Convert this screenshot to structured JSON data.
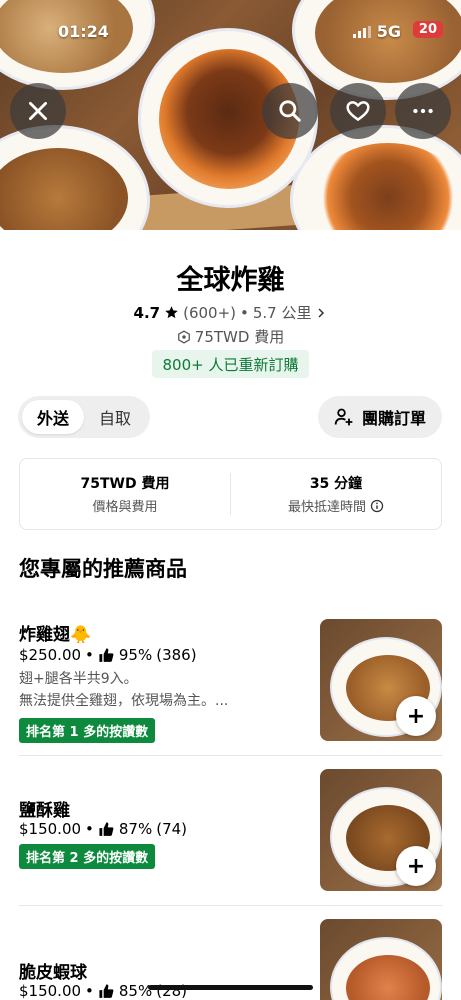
{
  "status_bar": {
    "time": "01:24",
    "network": "5G",
    "battery": "20"
  },
  "header_buttons": {
    "close": "close-icon",
    "search": "search-icon",
    "favorite": "heart-icon",
    "more": "more-icon"
  },
  "store": {
    "name": "全球炸雞",
    "rating": "4.7",
    "reviews": "(600+)",
    "distance": "5.7 公里",
    "fee": "75TWD 費用",
    "reorder_badge": "800+ 人已重新訂購"
  },
  "mode_toggle": {
    "options": [
      "外送",
      "自取"
    ],
    "selected": "外送"
  },
  "group_order": {
    "label": "團購訂單"
  },
  "info": {
    "fee_value": "75TWD 費用",
    "fee_label": "價格與費用",
    "time_value": "35 分鐘",
    "time_label": "最快抵達時間"
  },
  "section_title": "您專屬的推薦商品",
  "items": [
    {
      "name": "炸雞翅🐥",
      "price": "$250.00",
      "approval": "95%",
      "votes": "(386)",
      "desc1": "翅+腿各半共9入。",
      "desc2": "無法提供全雞翅，依現場為主。...",
      "badge": "排名第 1 多的按讚數"
    },
    {
      "name": "鹽酥雞",
      "price": "$150.00",
      "approval": "87%",
      "votes": "(74)",
      "badge": "排名第 2 多的按讚數"
    },
    {
      "name": "脆皮蝦球",
      "price": "$150.00",
      "approval": "85%",
      "votes": "(28)"
    }
  ],
  "colors": {
    "accent_green": "#0e8a3e",
    "reorder_bg": "#e7f5ec",
    "reorder_text": "#0d7a36",
    "battery_red": "#e03b3b"
  }
}
